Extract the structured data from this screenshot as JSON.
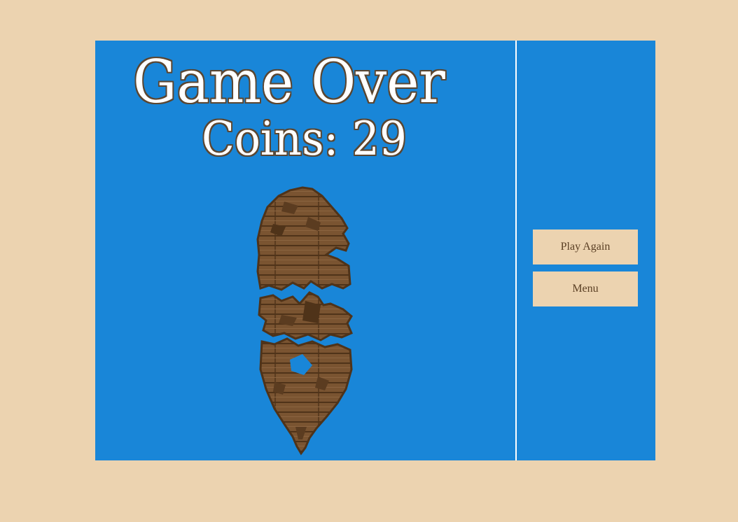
{
  "game": {
    "title": "Game Over",
    "coins_label": "Coins:",
    "coins_value": "29"
  },
  "menu": {
    "play_again_label": "Play Again",
    "menu_label": "Menu"
  },
  "colors": {
    "page_background": "#ecd3b0",
    "sea": "#1986d8",
    "button_bg": "#ecd3b0",
    "button_text": "#5a3f24",
    "text_fill": "#ffffff",
    "text_outline": "#5b4631",
    "wood": "#7a5431",
    "wood_dark": "#4f3319"
  },
  "sprite": {
    "name": "wrecked-ship-sprite"
  }
}
